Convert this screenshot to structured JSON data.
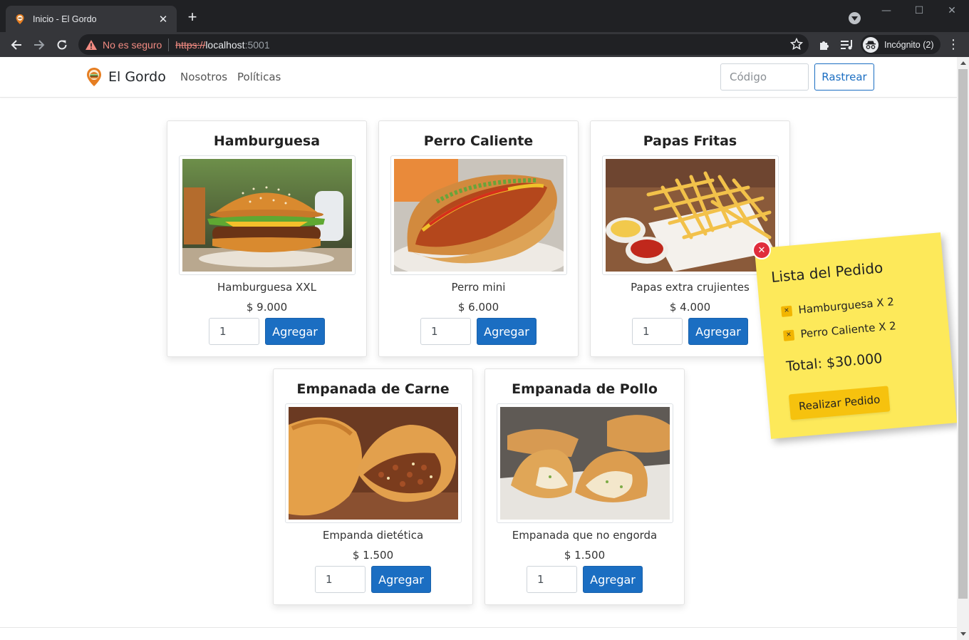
{
  "browser": {
    "tab_title": "Inicio - El Gordo",
    "security_label": "No es seguro",
    "url_scheme": "https://",
    "url_host": "localhost",
    "url_port": ":5001",
    "profile_label": "Incógnito (2)"
  },
  "navbar": {
    "brand": "El Gordo",
    "links": [
      "Nosotros",
      "Políticas"
    ],
    "code_placeholder": "Código",
    "track_label": "Rastrear"
  },
  "products": [
    {
      "name": "Hamburguesa",
      "description": "Hamburguesa XXL",
      "price": "$ 9.000",
      "qty": "1",
      "add_label": "Agregar"
    },
    {
      "name": "Perro Caliente",
      "description": "Perro mini",
      "price": "$ 6.000",
      "qty": "1",
      "add_label": "Agregar"
    },
    {
      "name": "Papas Fritas",
      "description": "Papas extra crujientes",
      "price": "$ 4.000",
      "qty": "1",
      "add_label": "Agregar"
    },
    {
      "name": "Empanada de Carne",
      "description": "Empanda dietética",
      "price": "$ 1.500",
      "qty": "1",
      "add_label": "Agregar"
    },
    {
      "name": "Empanada de Pollo",
      "description": "Empanada que no engorda",
      "price": "$ 1.500",
      "qty": "1",
      "add_label": "Agregar"
    }
  ],
  "order": {
    "title": "Lista del Pedido",
    "items": [
      "Hamburguesa X 2",
      "Perro Caliente X 2"
    ],
    "total": "Total: $30.000",
    "submit_label": "Realizar Pedido"
  },
  "colors": {
    "primary": "#1b6ec2",
    "note": "#fde95a",
    "note_button": "#f6c20e",
    "close_badge": "#e02d3c"
  }
}
